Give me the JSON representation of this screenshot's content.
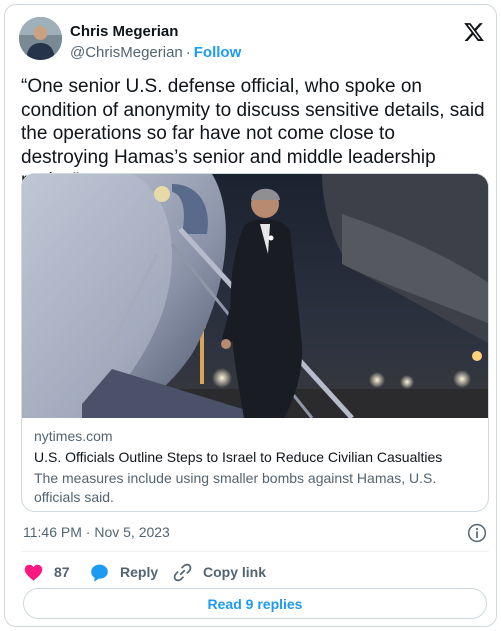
{
  "author": {
    "name": "Chris Megerian",
    "handle": "@ChrisMegerian",
    "separator": "·",
    "follow_label": "Follow"
  },
  "tweet": {
    "text": "“One senior U.S. defense official, who spoke on condition of anonymity to discuss sensitive details, said the operations so far have not come close to destroying Hamas’s senior and middle leadership ranks.”"
  },
  "link_card": {
    "domain": "nytimes.com",
    "title": "U.S. Officials Outline Steps to Israel to Reduce Civilian Casualties",
    "description": "The measures include using smaller bombs against Hamas, U.S. officials said."
  },
  "meta": {
    "time": "11:46 PM",
    "separator": "·",
    "date": "Nov 5, 2023"
  },
  "actions": {
    "like_count": "87",
    "reply_label": "Reply",
    "copy_label": "Copy link"
  },
  "replies_button": "Read 9 replies",
  "colors": {
    "accent": "#1d9bf0",
    "like": "#f91880",
    "text": "#0f1419",
    "secondary": "#536471"
  },
  "icons": [
    "x-logo-icon",
    "heart-icon",
    "reply-bubble-icon",
    "link-icon",
    "info-icon"
  ]
}
